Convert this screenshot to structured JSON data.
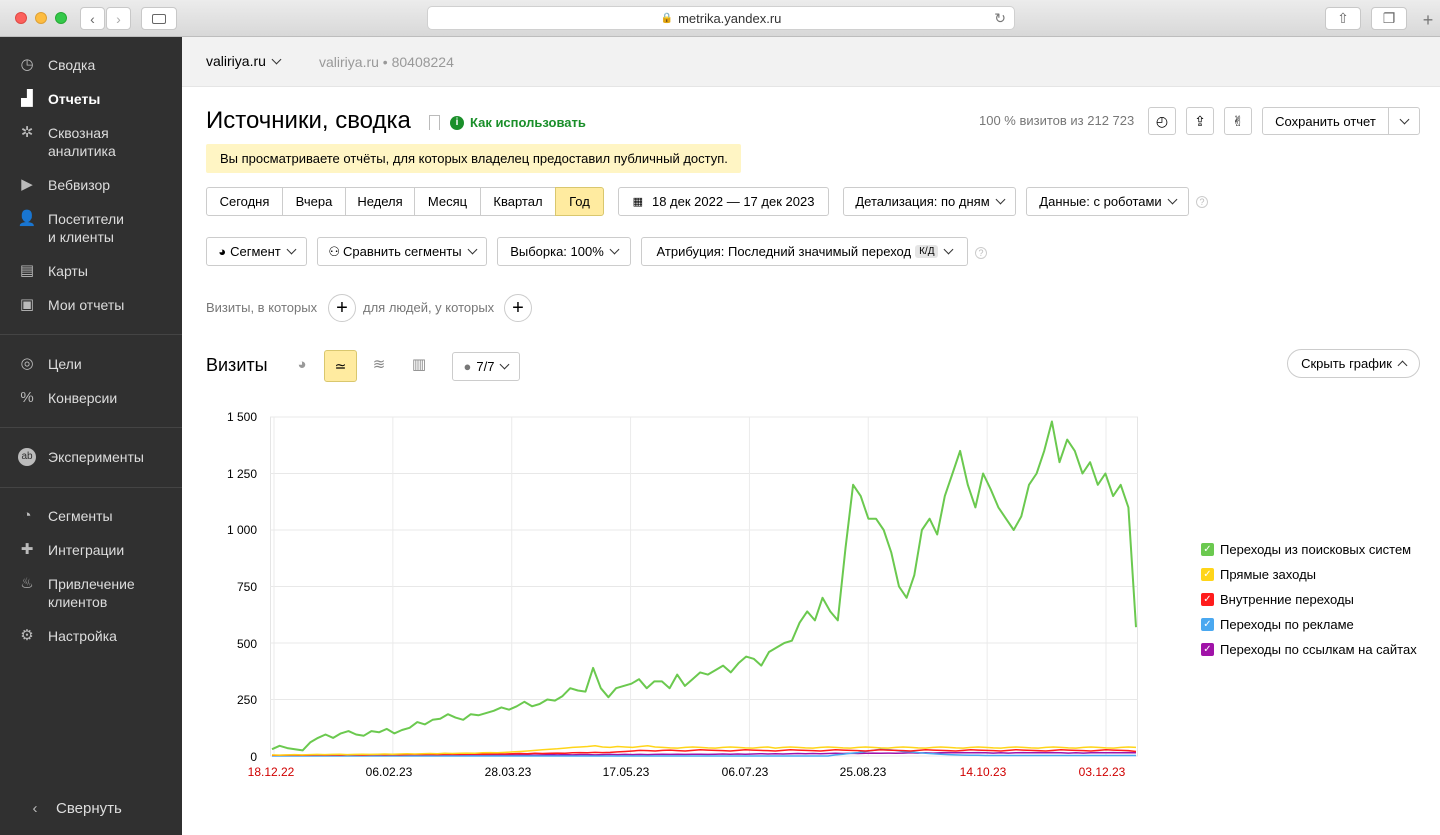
{
  "browser": {
    "url": "metrika.yandex.ru"
  },
  "sidebar": {
    "items": [
      {
        "label": "Сводка",
        "icon": "gauge-icon"
      },
      {
        "label": "Отчеты",
        "icon": "bar-chart-icon"
      },
      {
        "label": "Сквозная\nаналитика",
        "icon": "snowflake-icon"
      },
      {
        "label": "Вебвизор",
        "icon": "play-icon"
      },
      {
        "label": "Посетители\nи клиенты",
        "icon": "person-icon"
      },
      {
        "label": "Карты",
        "icon": "map-icon"
      },
      {
        "label": "Мои отчеты",
        "icon": "inbox-icon"
      },
      {
        "label": "Цели",
        "icon": "target-icon"
      },
      {
        "label": "Конверсии",
        "icon": "percent-icon"
      },
      {
        "label": "Эксперименты",
        "icon": "ab-icon"
      },
      {
        "label": "Сегменты",
        "icon": "pie-icon"
      },
      {
        "label": "Интеграции",
        "icon": "puzzle-icon"
      },
      {
        "label": "Привлечение\nклиентов",
        "icon": "flame-icon"
      },
      {
        "label": "Настройка",
        "icon": "gear-icon"
      }
    ],
    "collapse_label": "Свернуть"
  },
  "site": {
    "name": "valiriya.ru",
    "secondary": "valiriya.ru",
    "id": "80408224",
    "separator": "•"
  },
  "report": {
    "title": "Источники, сводка",
    "how_to_use": "Как использовать",
    "visits_share": "100 % визитов из 212 723",
    "save_label": "Сохранить отчет",
    "notice": "Вы просматриваете отчёты, для которых владелец предоставил публичный доступ."
  },
  "periods": [
    "Сегодня",
    "Вчера",
    "Неделя",
    "Месяц",
    "Квартал",
    "Год"
  ],
  "active_period": "Год",
  "date_range": "18 дек 2022 — 17 дек 2023",
  "detail": "Детализация: по дням",
  "data_robots": "Данные: с роботами",
  "filters": {
    "segment": "Сегмент",
    "compare": "Сравнить сегменты",
    "sample": "Выборка: 100%",
    "attribution": "Атрибуция: Последний значимый переход",
    "attribution_badge": "К/Д"
  },
  "conditions": {
    "visits_label": "Визиты, в которых",
    "people_label": "для людей, у которых"
  },
  "chart_header": {
    "title": "Визиты",
    "annotations": "7/7",
    "hide_label": "Скрыть график"
  },
  "colors": {
    "accent_yellow": "#ffeba0",
    "notice_bg": "#fff5c4",
    "green_link": "#1a8f2a"
  },
  "chart_data": {
    "type": "line",
    "ylim": [
      0,
      1500
    ],
    "y_ticks": [
      "0",
      "250",
      "500",
      "750",
      "1 000",
      "1 250",
      "1 500"
    ],
    "x_ticks": [
      {
        "label": "18.12.22",
        "holiday": true
      },
      {
        "label": "06.02.23",
        "holiday": false
      },
      {
        "label": "28.03.23",
        "holiday": false
      },
      {
        "label": "17.05.23",
        "holiday": false
      },
      {
        "label": "06.07.23",
        "holiday": false
      },
      {
        "label": "25.08.23",
        "holiday": false
      },
      {
        "label": "14.10.23",
        "holiday": true
      },
      {
        "label": "03.12.23",
        "holiday": true
      }
    ],
    "legend_position": "right",
    "series": [
      {
        "name": "Переходы из поисковых систем",
        "color": "#6bc94f",
        "values": [
          30,
          45,
          35,
          30,
          25,
          60,
          80,
          95,
          80,
          100,
          110,
          95,
          90,
          110,
          105,
          120,
          100,
          115,
          125,
          150,
          140,
          160,
          165,
          185,
          170,
          160,
          185,
          180,
          190,
          200,
          215,
          205,
          220,
          240,
          220,
          230,
          250,
          245,
          265,
          300,
          290,
          285,
          390,
          300,
          260,
          300,
          310,
          320,
          340,
          300,
          330,
          330,
          300,
          360,
          310,
          340,
          370,
          360,
          380,
          400,
          370,
          410,
          440,
          430,
          400,
          460,
          480,
          500,
          510,
          590,
          640,
          600,
          700,
          640,
          600,
          920,
          1200,
          1150,
          1050,
          1050,
          1000,
          900,
          750,
          700,
          800,
          1000,
          1050,
          980,
          1150,
          1250,
          1350,
          1200,
          1100,
          1250,
          1180,
          1100,
          1050,
          1000,
          1060,
          1200,
          1250,
          1350,
          1480,
          1300,
          1400,
          1350,
          1250,
          1300,
          1200,
          1250,
          1150,
          1200,
          1100,
          570
        ]
      },
      {
        "name": "Прямые заходы",
        "color": "#ffd519",
        "values": [
          5,
          4,
          5,
          6,
          5,
          6,
          7,
          6,
          7,
          8,
          6,
          7,
          8,
          7,
          8,
          9,
          8,
          9,
          10,
          9,
          10,
          11,
          10,
          12,
          11,
          12,
          13,
          12,
          14,
          15,
          14,
          16,
          18,
          20,
          22,
          25,
          28,
          30,
          32,
          35,
          38,
          40,
          42,
          45,
          40,
          38,
          42,
          40,
          38,
          42,
          45,
          40,
          38,
          36,
          35,
          38,
          40,
          38,
          36,
          35,
          38,
          40,
          38,
          36,
          35,
          38,
          40,
          35,
          38,
          40,
          38,
          36,
          35,
          38,
          40,
          38,
          36,
          35,
          38,
          40,
          38,
          36,
          35,
          38,
          40,
          38,
          36,
          35,
          38,
          40,
          38,
          36,
          35,
          38,
          40,
          38,
          36,
          35,
          38,
          40,
          38,
          36,
          35,
          38,
          40,
          38,
          36,
          35,
          38,
          40,
          38,
          36,
          35,
          38,
          40,
          38
        ]
      },
      {
        "name": "Внутренние переходы",
        "color": "#ff1c1c",
        "values": [
          3,
          3,
          4,
          4,
          3,
          4,
          5,
          4,
          5,
          4,
          5,
          5,
          4,
          5,
          6,
          5,
          6,
          5,
          6,
          7,
          6,
          7,
          6,
          7,
          8,
          7,
          8,
          9,
          8,
          9,
          10,
          9,
          10,
          11,
          10,
          12,
          11,
          12,
          13,
          12,
          14,
          15,
          14,
          16,
          15,
          16,
          18,
          20,
          22,
          25,
          24,
          22,
          25,
          26,
          24,
          22,
          25,
          28,
          26,
          25,
          24,
          22,
          25,
          28,
          26,
          25,
          24,
          22,
          25,
          28,
          26,
          25,
          24,
          22,
          25,
          28,
          26,
          25,
          24,
          22,
          25,
          28,
          26,
          25,
          24,
          22,
          25,
          28,
          26,
          25,
          24,
          22,
          25,
          28,
          26,
          25,
          24,
          22,
          25,
          28,
          26,
          25,
          24,
          22,
          25,
          28,
          26,
          25,
          24,
          22,
          25,
          28,
          26,
          25,
          24,
          20
        ]
      },
      {
        "name": "Переходы по рекламе",
        "color": "#4aa8f0",
        "values": [
          0,
          0,
          0,
          0,
          0,
          0,
          0,
          0,
          0,
          0,
          0,
          0,
          0,
          0,
          0,
          0,
          0,
          0,
          0,
          0,
          0,
          0,
          0,
          0,
          0,
          0,
          0,
          0,
          0,
          0,
          0,
          0,
          0,
          0,
          0,
          0,
          0,
          0,
          0,
          0,
          0,
          0,
          0,
          0,
          0,
          0,
          0,
          0,
          0,
          0,
          0,
          0,
          0,
          0,
          0,
          0,
          0,
          0,
          0,
          0,
          0,
          0,
          0,
          0,
          0,
          0,
          0,
          0,
          0,
          0,
          0,
          0,
          0,
          0,
          0,
          5,
          8,
          12,
          15,
          20,
          25,
          30,
          28,
          25,
          20,
          18,
          15,
          12,
          10,
          8,
          6,
          5,
          4,
          3,
          3,
          2,
          2,
          2,
          2,
          2,
          2,
          2,
          2,
          2,
          2,
          2,
          2,
          2,
          2,
          2,
          2,
          2,
          2,
          2,
          2,
          2
        ]
      },
      {
        "name": "Переходы по ссылкам на сайтах",
        "color": "#a013a8",
        "values": [
          2,
          2,
          2,
          2,
          2,
          2,
          2,
          3,
          2,
          3,
          2,
          3,
          3,
          2,
          3,
          3,
          2,
          3,
          3,
          4,
          3,
          4,
          3,
          4,
          3,
          4,
          4,
          3,
          4,
          5,
          4,
          5,
          4,
          5,
          5,
          4,
          5,
          6,
          5,
          6,
          5,
          6,
          6,
          5,
          6,
          7,
          6,
          7,
          6,
          7,
          6,
          7,
          8,
          7,
          8,
          7,
          8,
          8,
          7,
          8,
          9,
          8,
          9,
          8,
          9,
          10,
          9,
          10,
          9,
          10,
          11,
          10,
          11,
          10,
          11,
          12,
          11,
          12,
          11,
          12,
          13,
          12,
          13,
          12,
          13,
          14,
          13,
          14,
          13,
          14,
          15,
          14,
          15,
          14,
          15,
          14,
          13,
          14,
          13,
          14,
          15,
          14,
          15,
          14,
          15,
          14,
          13,
          14,
          13,
          14,
          15,
          14,
          15,
          14,
          15,
          14
        ]
      }
    ]
  }
}
